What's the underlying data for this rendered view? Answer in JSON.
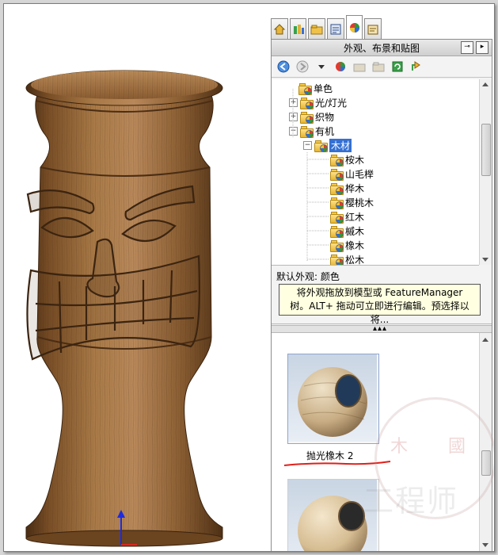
{
  "pane": {
    "title": "外观、布景和贴图",
    "tabs": [
      "home-tab-icon",
      "design-library-tab-icon",
      "file-explorer-tab-icon",
      "view-palette-tab-icon",
      "appearances-tab-icon",
      "custom-properties-tab-icon"
    ],
    "active_tab": 4
  },
  "toolbar": {
    "buttons": [
      "back-icon",
      "forward-icon",
      "dropdown-icon",
      "appearance-icon",
      "folder-icon",
      "new-folder-icon",
      "refresh-icon",
      "up-folder-icon"
    ]
  },
  "tree": {
    "items": [
      {
        "label": "单色",
        "expander": ""
      },
      {
        "label": "光/灯光",
        "expander": "+"
      },
      {
        "label": "织物",
        "expander": "+"
      },
      {
        "label": "有机",
        "expander": "−"
      },
      {
        "label": "木材",
        "expander": "−"
      },
      {
        "label": "桉木",
        "expander": ""
      },
      {
        "label": "山毛榉",
        "expander": ""
      },
      {
        "label": "桦木",
        "expander": ""
      },
      {
        "label": "樱桃木",
        "expander": ""
      },
      {
        "label": "红木",
        "expander": ""
      },
      {
        "label": "槭木",
        "expander": ""
      },
      {
        "label": "橡木",
        "expander": ""
      },
      {
        "label": "松木",
        "expander": ""
      }
    ],
    "selected": "木材"
  },
  "info": {
    "default_appearance": "默认外观: 颜色",
    "tooltip_line1": "将外观拖放到模型或 FeatureManager",
    "tooltip_line2": "树。ALT+ 拖动可立即进行编辑。预选择以将..."
  },
  "gallery": {
    "items": [
      {
        "label": "抛光橡木 2"
      },
      {
        "label": ""
      }
    ]
  },
  "watermark": {
    "seal": "木 國",
    "text": "工程师"
  },
  "colors": {
    "selection": "#3470d3",
    "tooltip_bg": "#ffffe1",
    "annotation_red": "#e0201a",
    "wood": "#9c6b3c"
  }
}
